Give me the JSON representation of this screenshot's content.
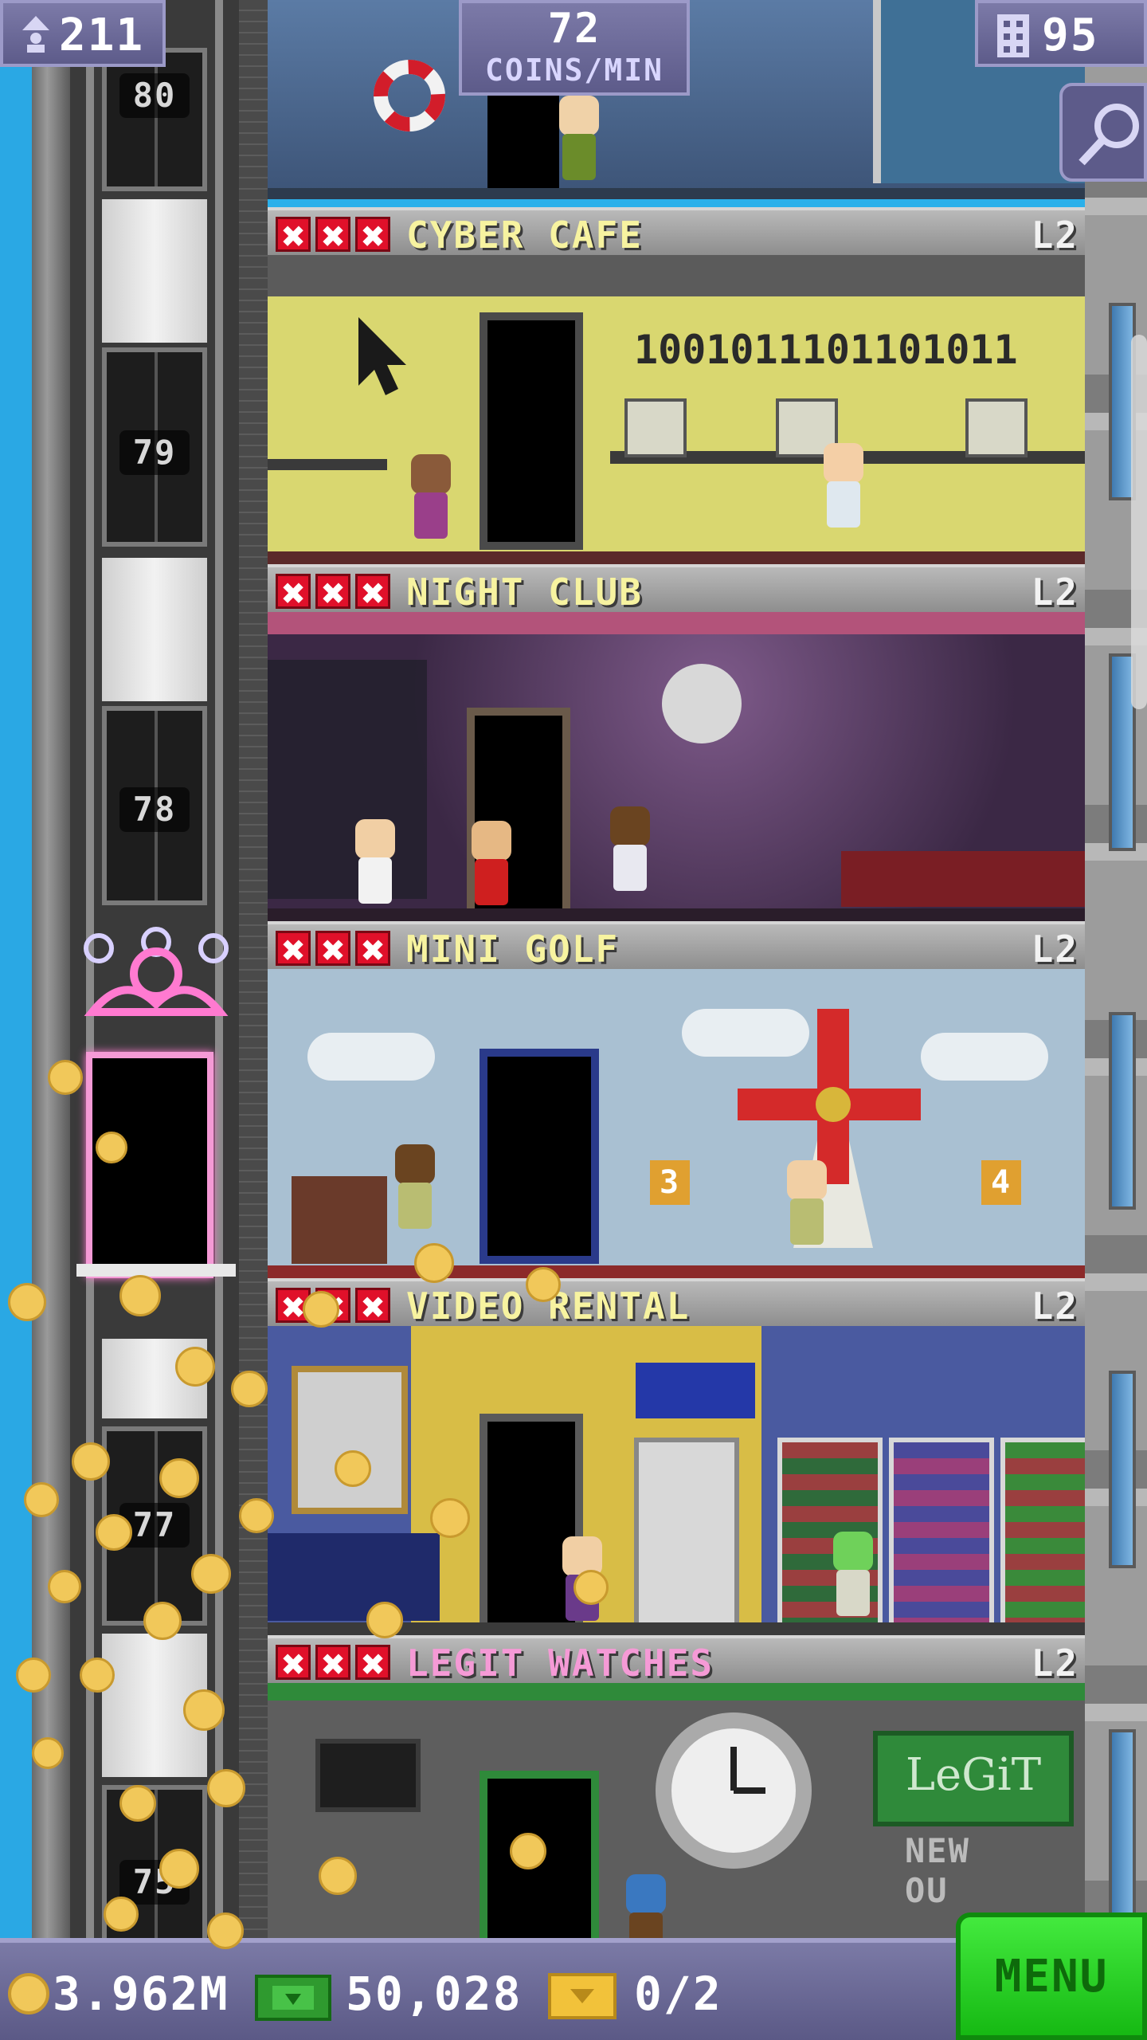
{
  "hud": {
    "population": "211",
    "coins_per_min_value": "72",
    "coins_per_min_label": "COINS/MIN",
    "floors": "95"
  },
  "shaft": {
    "floor_numbers": [
      "80",
      "79",
      "78",
      "77",
      "75"
    ]
  },
  "floors": [
    {
      "name": "CYBER CAFE",
      "level": "L2",
      "title_color": "#f7f3a0",
      "binary": "1001011101101011"
    },
    {
      "name": "NIGHT CLUB",
      "level": "L2",
      "title_color": "#f7f3a0"
    },
    {
      "name": "MINI GOLF",
      "level": "L2",
      "title_color": "#f7f3a0",
      "hole_signs": [
        "3",
        "4"
      ]
    },
    {
      "name": "VIDEO RENTAL",
      "level": "L2",
      "title_color": "#f7f3a0"
    },
    {
      "name": "LEGIT WATCHES",
      "level": "L2",
      "title_color": "#f59ad6",
      "signs": [
        "LeGiT",
        "NEW",
        "OU"
      ]
    }
  ],
  "bottom_bar": {
    "coins": "3.962M",
    "bux": "50,028",
    "tickets": "0/2",
    "menu_label": "MENU"
  },
  "icons": [
    "person-up-icon",
    "building-icon",
    "magnifier-icon",
    "coin-icon",
    "bux-icon",
    "ticket-icon",
    "star-icon"
  ],
  "colors": {
    "hud": "#5d5b8a",
    "menu": "#2bd826",
    "star": "#e0102a",
    "coin": "#f1c85a"
  }
}
